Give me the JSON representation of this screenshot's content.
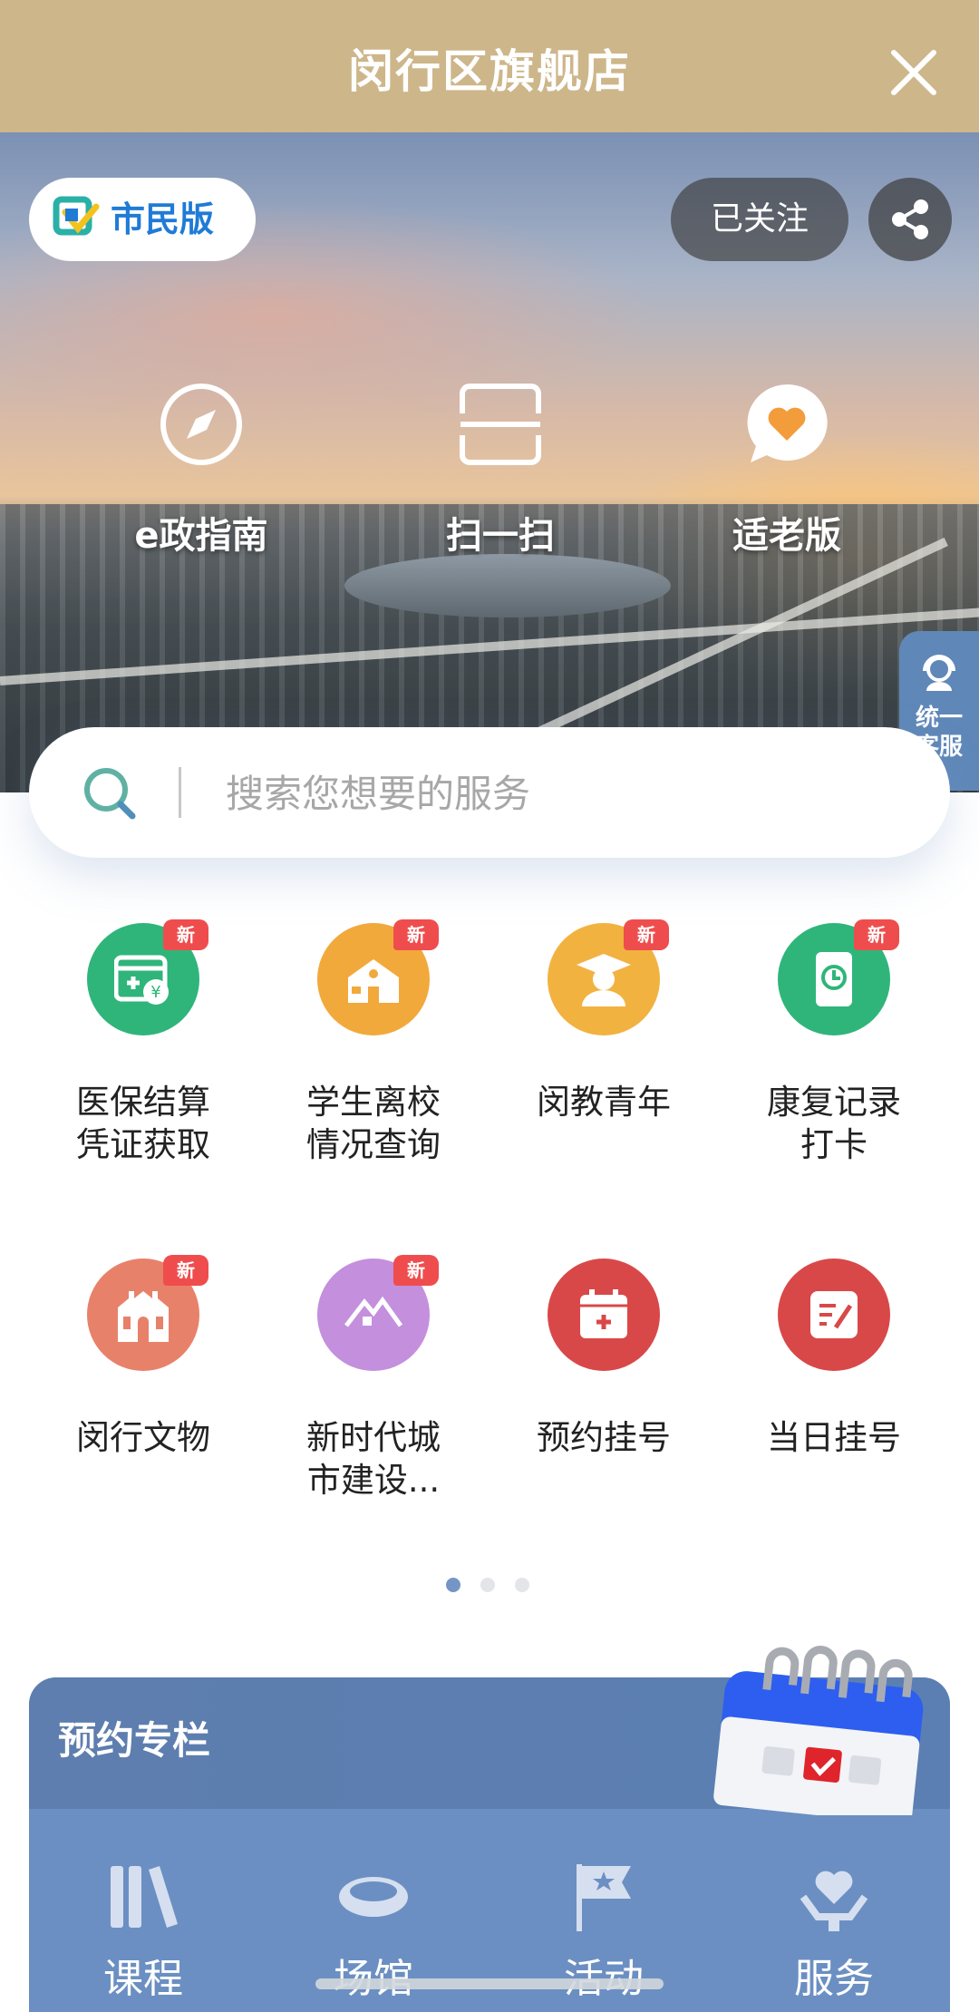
{
  "titlebar": {
    "title": "闵行区旗舰店",
    "close_icon": "close-icon"
  },
  "hero": {
    "citizen_pill": "市民版",
    "follow_button": "已关注",
    "share_icon": "share-icon",
    "quick_actions": [
      {
        "label": "e政指南",
        "icon": "compass-icon"
      },
      {
        "label": "扫一扫",
        "icon": "scan-icon"
      },
      {
        "label": "适老版",
        "icon": "heart-chat-icon"
      }
    ],
    "float_service": "统一客服"
  },
  "search": {
    "placeholder": "搜索您想要的服务"
  },
  "services": [
    {
      "label": "医保结算凭证获取",
      "badge": "新",
      "color": "#2fb57a",
      "icon": "medical-card-icon"
    },
    {
      "label": "学生离校情况查询",
      "badge": "新",
      "color": "#f2a93b",
      "icon": "school-icon"
    },
    {
      "label": "闵教青年",
      "badge": "新",
      "color": "#f2b240",
      "icon": "graduate-icon"
    },
    {
      "label": "康复记录打卡",
      "badge": "新",
      "color": "#2fb57a",
      "icon": "phone-clock-icon"
    },
    {
      "label": "闵行文物",
      "badge": "新",
      "color": "#e8816a",
      "icon": "heritage-icon"
    },
    {
      "label": "新时代城市建设...",
      "badge": "新",
      "color": "#c48fdc",
      "icon": "house-icon"
    },
    {
      "label": "预约挂号",
      "badge": "",
      "color": "#d94848",
      "icon": "calendar-plus-icon"
    },
    {
      "label": "当日挂号",
      "badge": "",
      "color": "#d94848",
      "icon": "note-edit-icon"
    }
  ],
  "pager": {
    "pages": 3,
    "active": 0
  },
  "booking": {
    "title": "预约专栏",
    "tabs": [
      {
        "label": "课程",
        "icon": "books-icon"
      },
      {
        "label": "场馆",
        "icon": "stadium-icon"
      },
      {
        "label": "活动",
        "icon": "flag-star-icon"
      },
      {
        "label": "服务",
        "icon": "hand-heart-icon"
      }
    ]
  }
}
